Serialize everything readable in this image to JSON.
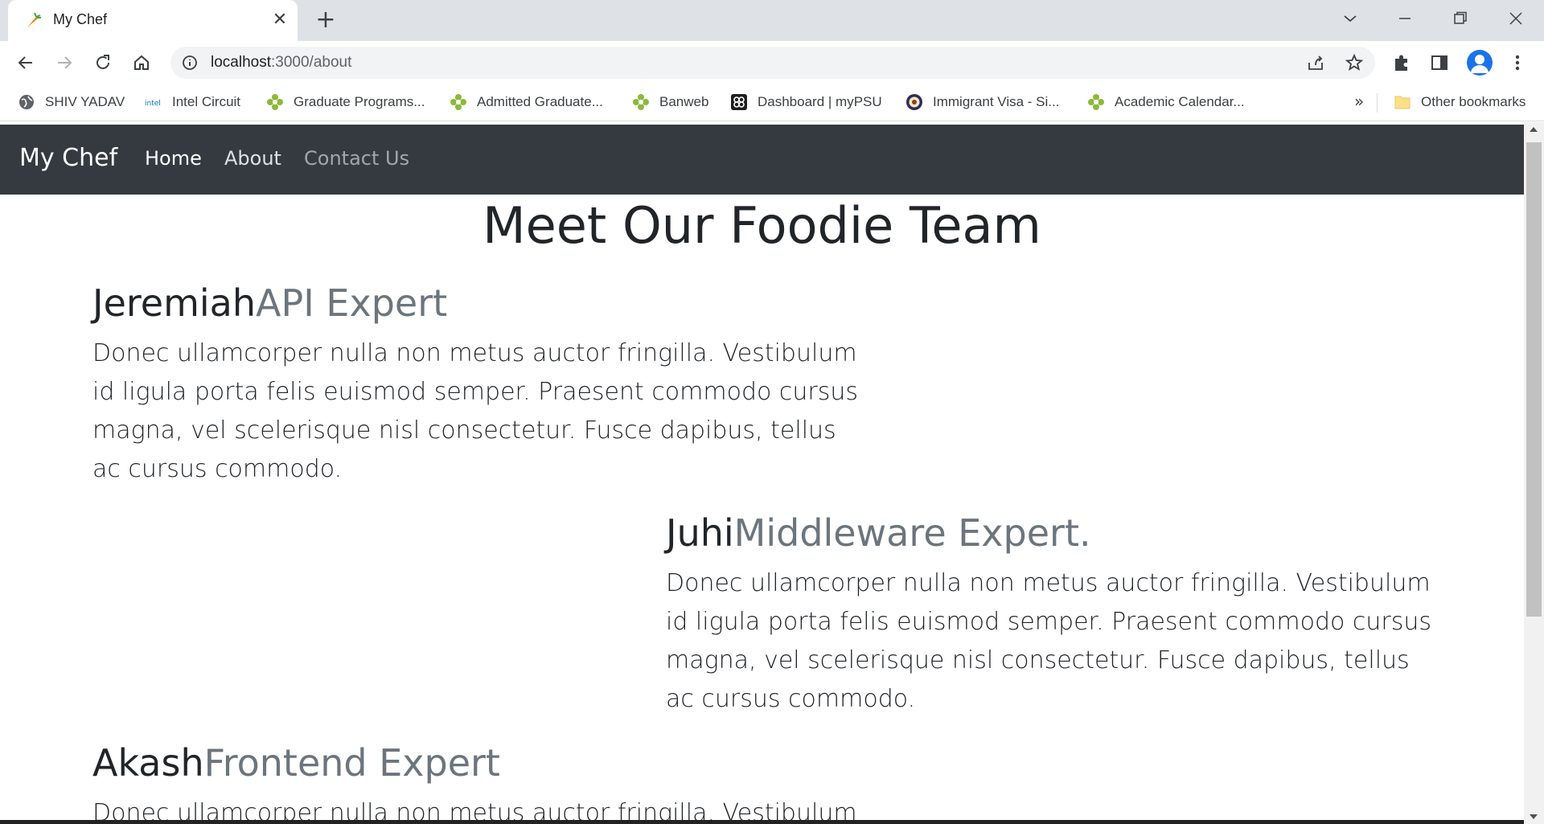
{
  "browser": {
    "tab_title": "My Chef",
    "url_host": "localhost",
    "url_path": ":3000/about",
    "bookmarks": [
      {
        "label": "SHIV YADAV",
        "icon": "globe-icon"
      },
      {
        "label": "Intel Circuit",
        "icon": "intel-icon"
      },
      {
        "label": "Graduate Programs...",
        "icon": "clover-icon"
      },
      {
        "label": "Admitted Graduate...",
        "icon": "clover-icon"
      },
      {
        "label": "Banweb",
        "icon": "clover-icon"
      },
      {
        "label": "Dashboard | myPSU",
        "icon": "psu-icon"
      },
      {
        "label": "Immigrant Visa - Si...",
        "icon": "seal-icon"
      },
      {
        "label": "Academic Calendar...",
        "icon": "clover-icon"
      }
    ],
    "bookmarks_overflow": "»",
    "other_bookmarks": "Other bookmarks",
    "colors": {
      "tabstrip": "#dee1e6",
      "accent": "#1a73e8"
    }
  },
  "site": {
    "brand": "My Chef",
    "nav": {
      "home": "Home",
      "about": "About",
      "contact": "Contact Us"
    },
    "colors": {
      "navbar": "#343a40",
      "muted": "#6c757d",
      "text": "#212529"
    }
  },
  "main": {
    "title": "Meet Our Foodie Team",
    "members": [
      {
        "name": "Jeremiah",
        "role": "API Expert",
        "bio": "Donec ullamcorper nulla non metus auctor fringilla. Vestibulum id ligula porta felis euismod semper. Praesent commodo cursus magna, vel scelerisque nisl consectetur. Fusce dapibus, tellus ac cursus commodo."
      },
      {
        "name": "Juhi",
        "role": "Middleware Expert.",
        "bio": "Donec ullamcorper nulla non metus auctor fringilla. Vestibulum id ligula porta felis euismod semper. Praesent commodo cursus magna, vel scelerisque nisl consectetur. Fusce dapibus, tellus ac cursus commodo."
      },
      {
        "name": "Akash",
        "role": "Frontend Expert",
        "bio": "Donec ullamcorper nulla non metus auctor fringilla. Vestibulum"
      }
    ]
  }
}
